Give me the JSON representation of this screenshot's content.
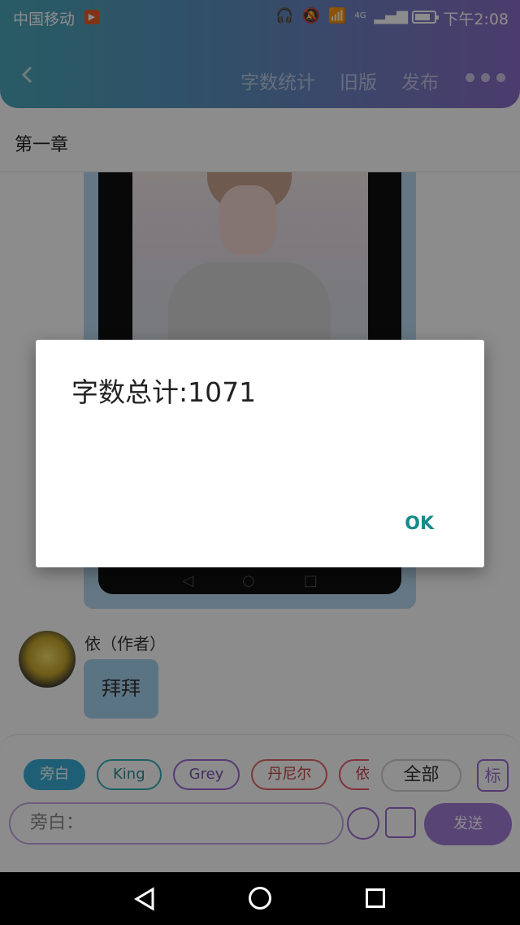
{
  "status_bar": {
    "carrier": "中国移动",
    "carrier_badge": "▶",
    "network": "4G",
    "time": "下午2:08",
    "icons": [
      "headset-icon",
      "mute-icon",
      "wifi-icon",
      "signal-icon",
      "battery-icon"
    ]
  },
  "header": {
    "back_icon": "back-arrow-icon",
    "actions": [
      "字数统计",
      "旧版",
      "发布"
    ],
    "more_icon": "more-dots-icon",
    "gradient": [
      "#4aa7b9",
      "#8a6cc6"
    ]
  },
  "chapter": {
    "title": "第一章"
  },
  "message": {
    "author": "依（作者）",
    "text": "拜拜"
  },
  "composer": {
    "roles": [
      "旁白",
      "King",
      "Grey",
      "丹尼尔",
      "依（"
    ],
    "all_label": "全部",
    "biao_label": "标",
    "input_placeholder": "旁白：",
    "send_label": "发送"
  },
  "dialog": {
    "message": "字数总计:1071",
    "ok_label": "OK"
  }
}
